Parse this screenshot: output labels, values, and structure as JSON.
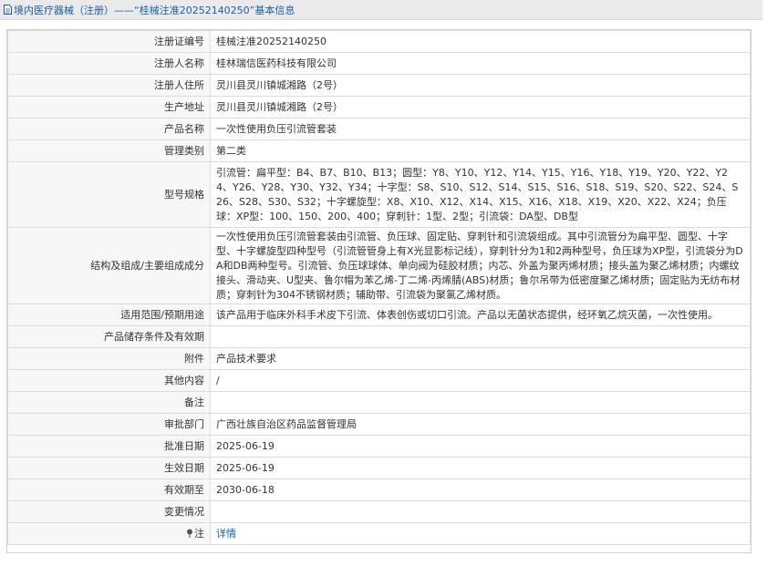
{
  "header": {
    "title": "境内医疗器械（注册）——“桂械注准20252140250”基本信息"
  },
  "rows": [
    {
      "label": "注册证编号",
      "value": "桂械注准20252140250"
    },
    {
      "label": "注册人名称",
      "value": "桂林瑞信医药科技有限公司"
    },
    {
      "label": "注册人住所",
      "value": "灵川县灵川镇城湘路（2号）"
    },
    {
      "label": "生产地址",
      "value": "灵川县灵川镇城湘路（2号）"
    },
    {
      "label": "产品名称",
      "value": "一次性使用负压引流管套装"
    },
    {
      "label": "管理类别",
      "value": "第二类"
    },
    {
      "label": "型号规格",
      "value": "引流管：扁平型：B4、B7、B10、B13；圆型：Y8、Y10、Y12、Y14、Y15、Y16、Y18、Y19、Y20、Y22、Y24、Y26、Y28、Y30、Y32、Y34；十字型：S8、S10、S12、S14、S15、S16、S18、S19、S20、S22、S24、S26、S28、S30、S32；十字螺旋型：X8、X10、X12、X14、X15、X16、X18、X19、X20、X22、X24；负压球：XP型：100、150、200、400；穿刺针：1型、2型；引流袋：DA型、DB型"
    },
    {
      "label": "结构及组成/主要组成成分",
      "value": "一次性使用负压引流管套装由引流管、负压球、固定贴、穿刺针和引流袋组成。其中引流管分为扁平型、圆型、十字型、十字螺旋型四种型号（引流管管身上有X光显影标记线），穿刺针分为1和2两种型号，负压球为XP型，引流袋分为DA和DB两种型号。引流管、负压球球体、单向阀为硅胶材质；内芯、外盖为聚丙烯材质；接头盖为聚乙烯材质；内螺纹接头、滑动夹、U型夹、鲁尔帽为苯乙烯-丁二烯-丙烯腈(ABS)材质；鲁尔吊带为低密度聚乙烯材质；固定贴为无纺布材质；穿刺针为304不锈钢材质；辅助带、引流袋为聚氯乙烯材质。"
    },
    {
      "label": "适用范围/预期用途",
      "value": "该产品用于临床外科手术皮下引流、体表创伤或切口引流。产品以无菌状态提供，经环氧乙烷灭菌，一次性使用。"
    },
    {
      "label": "产品储存条件及有效期",
      "value": ""
    },
    {
      "label": "附件",
      "value": "产品技术要求"
    },
    {
      "label": "其他内容",
      "value": "/"
    },
    {
      "label": "备注",
      "value": ""
    },
    {
      "label": "审批部门",
      "value": "广西壮族自治区药品监督管理局"
    },
    {
      "label": "批准日期",
      "value": "2025-06-19"
    },
    {
      "label": "生效日期",
      "value": "2025-06-19"
    },
    {
      "label": "有效期至",
      "value": "2030-06-18"
    },
    {
      "label": "变更情况",
      "value": ""
    },
    {
      "label": "注",
      "value": "详情"
    }
  ],
  "icons": {
    "title": "document-icon",
    "note": "pin-icon"
  },
  "colors": {
    "link": "#1a5fa8",
    "header_bg": "#eaeaea",
    "label_bg": "#f7f7f7"
  }
}
